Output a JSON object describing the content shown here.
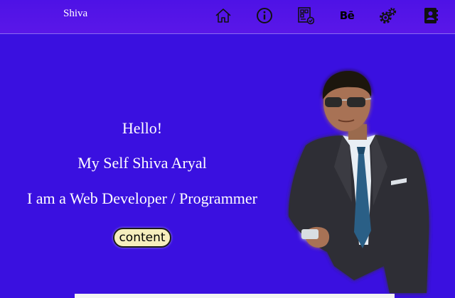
{
  "navbar": {
    "brand": "Shiva",
    "icons": [
      {
        "name": "home-icon",
        "label": "Home"
      },
      {
        "name": "info-icon",
        "label": "About"
      },
      {
        "name": "portfolio-icon",
        "label": "Portfolio"
      },
      {
        "name": "behance-icon",
        "label": "Bē"
      },
      {
        "name": "settings-icon",
        "label": "Settings"
      },
      {
        "name": "contact-icon",
        "label": "Contact"
      }
    ]
  },
  "hero": {
    "greeting": "Hello!",
    "name_line": "My Self Shiva Aryal",
    "role_line": "I am a Web Developer / Programmer",
    "button_label": "content"
  },
  "colors": {
    "background": "#3a10e0",
    "navbar": "#5214e6",
    "button": "#f6eebd",
    "text": "#ffffff"
  }
}
